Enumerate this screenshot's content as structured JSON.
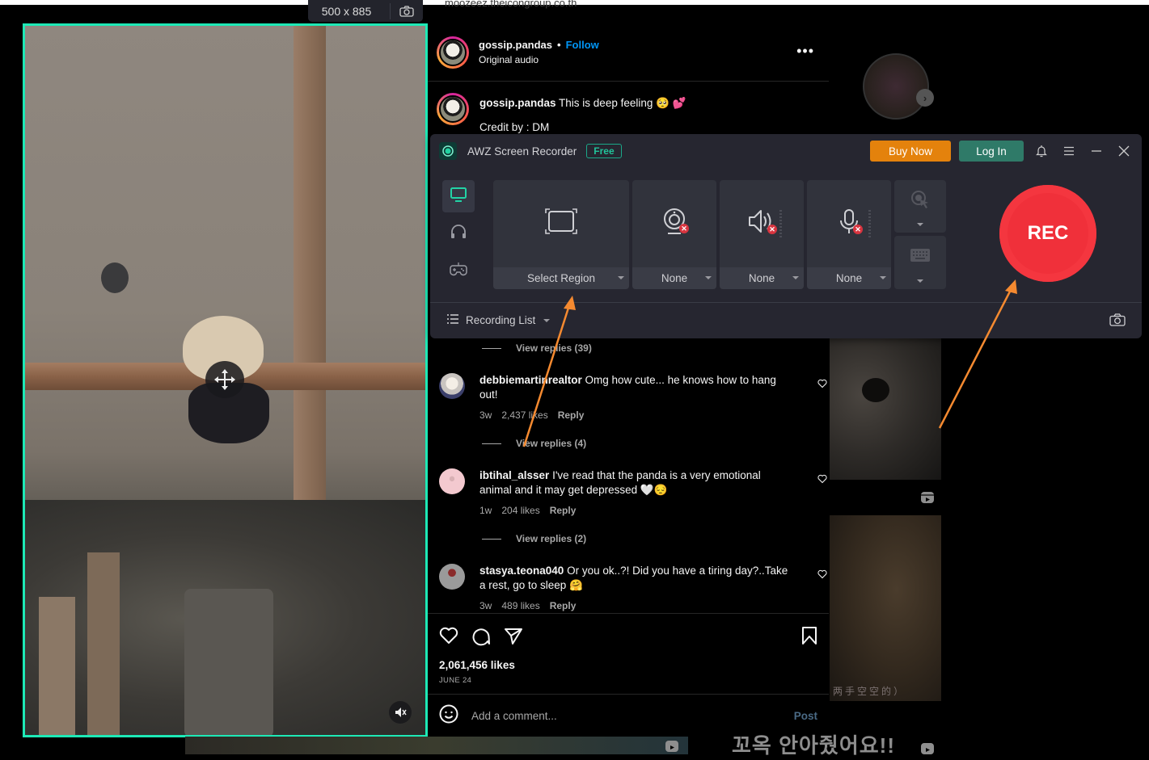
{
  "browser": {
    "url_fragment": "moozeez.theicongroup.co.th"
  },
  "capture": {
    "dimensions": "500 x 885",
    "screenshot_icon": "camera-icon",
    "move_icon": "move-arrows-icon",
    "mute_icon": "muted-speaker-icon"
  },
  "post": {
    "username": "gossip.pandas",
    "separator": "•",
    "follow_label": "Follow",
    "audio": "Original audio",
    "more_icon": "more-options-icon",
    "caption": {
      "username": "gossip.pandas",
      "text": "This is deep feeling 🥺 💕",
      "credit": "Credit by : DM"
    },
    "comments": [
      {
        "view_replies": "View replies (39)"
      },
      {
        "username": "debbiemartinrealtor",
        "text": "Omg how cute... he knows how to hang out!",
        "age": "3w",
        "likes": "2,437 likes",
        "reply": "Reply",
        "view_replies": "View replies (4)"
      },
      {
        "username": "ibtihal_alsser",
        "text": "I've read that the panda is a very emotional animal and it may get depressed 🤍😔",
        "age": "1w",
        "likes": "204 likes",
        "reply": "Reply",
        "view_replies": "View replies (2)"
      },
      {
        "username": "stasya.teona040",
        "text": "Or you ok..?! Did you have a tiring day?..Take a rest, go to sleep 🤗",
        "age": "3w",
        "likes": "489 likes",
        "reply": "Reply"
      }
    ],
    "likes_count": "2,061,456 likes",
    "date": "JUNE 24",
    "add_comment_placeholder": "Add a comment...",
    "post_button": "Post"
  },
  "sidebar_thumbs": {
    "thumb2_caption": "两手空空的）",
    "bottom_text": "꼬옥 안아줬어요!!"
  },
  "recorder": {
    "app_name": "AWZ Screen Recorder",
    "plan_badge": "Free",
    "buy_now": "Buy Now",
    "log_in": "Log In",
    "modes": [
      {
        "name": "screen",
        "icon": "monitor-icon",
        "active": true
      },
      {
        "name": "audio",
        "icon": "headphones-icon",
        "active": false
      },
      {
        "name": "game",
        "icon": "gamepad-icon",
        "active": false
      }
    ],
    "region_label": "Select Region",
    "webcam_label": "None",
    "system_audio_label": "None",
    "microphone_label": "None",
    "rec_label": "REC",
    "recording_list": "Recording List",
    "accent": "#1de9b6",
    "rec_color": "#f0303a",
    "buy_color": "#e4820c",
    "login_color": "#2f7a68"
  }
}
